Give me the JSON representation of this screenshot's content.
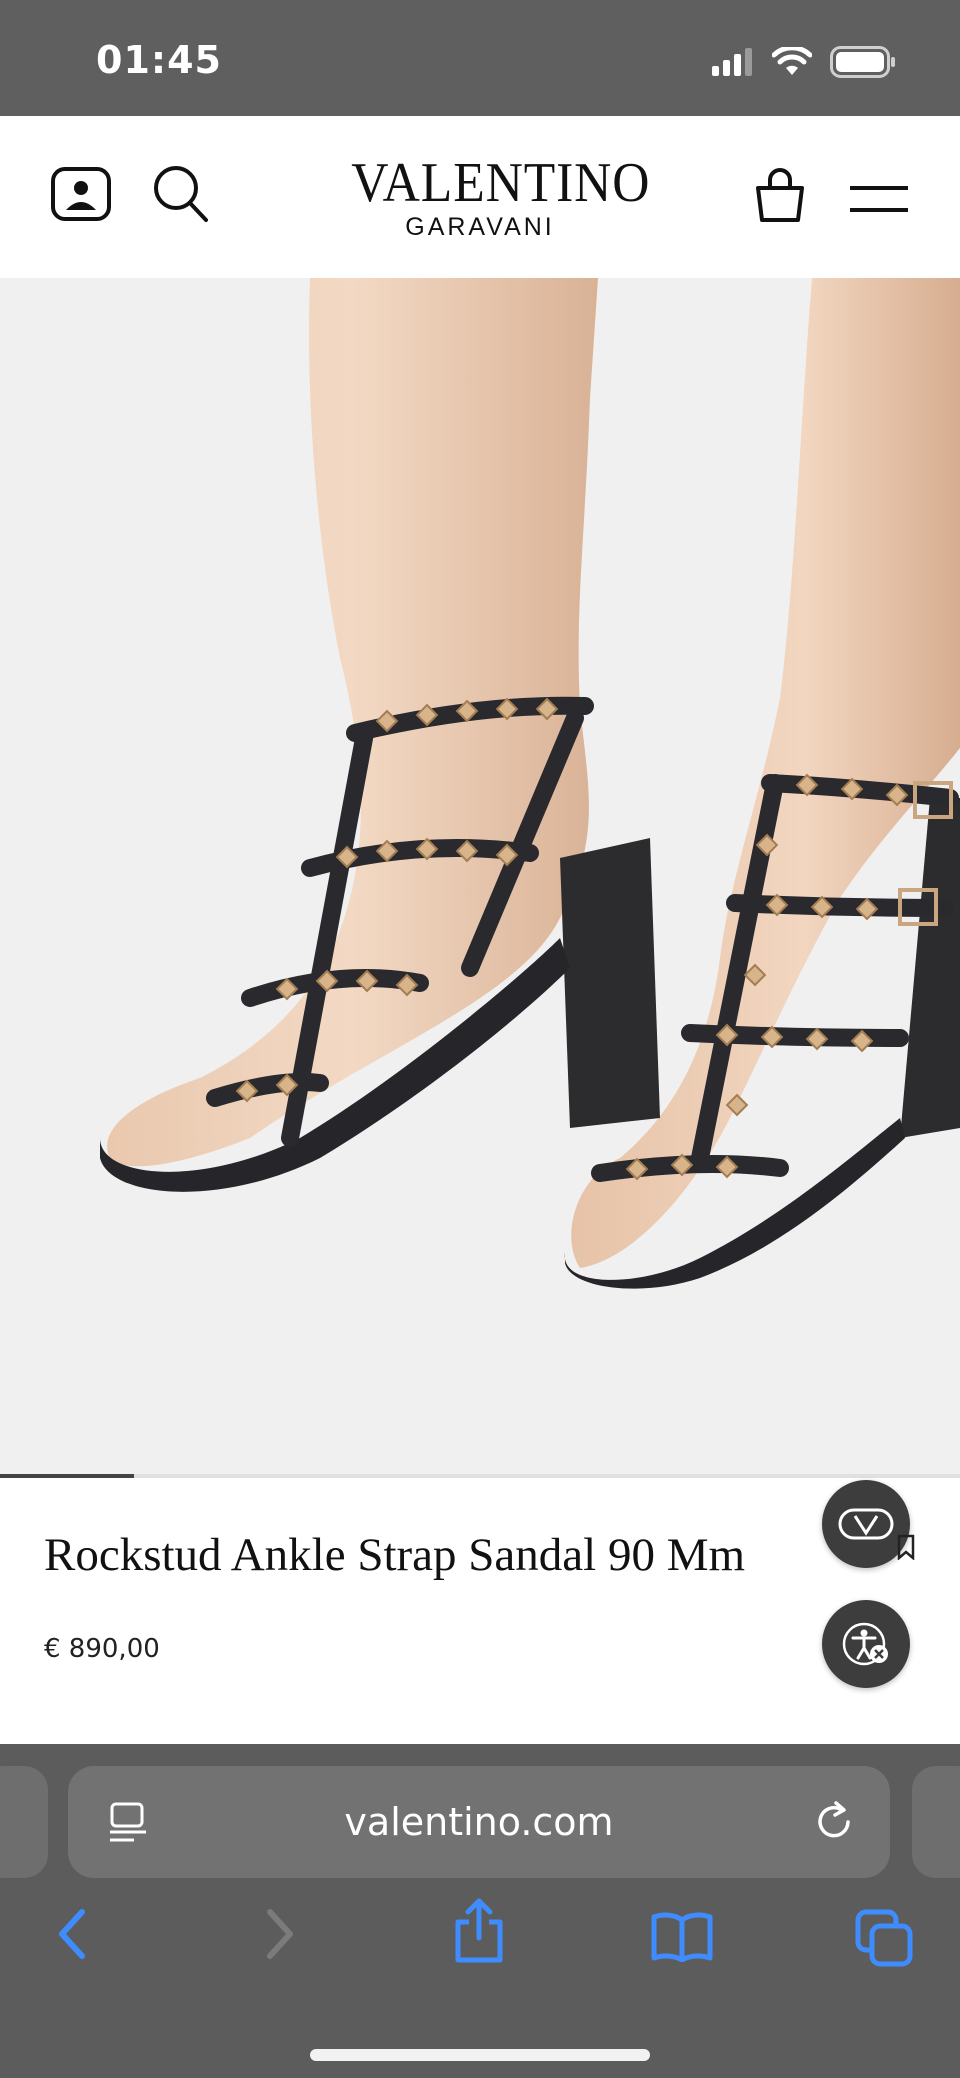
{
  "status_bar": {
    "time": "01:45"
  },
  "header": {
    "brand_name": "VALENTINO",
    "brand_sub": "GARAVANI"
  },
  "carousel": {
    "progress": 0.14
  },
  "product": {
    "title": "Rockstud Ankle Strap Sandal 90 Mm",
    "price": "€ 890,00"
  },
  "browser": {
    "url": "valentino.com"
  },
  "icons": {
    "account": "account-icon",
    "search": "search-icon",
    "bag": "shopping-bag-icon",
    "menu": "hamburger-menu-icon",
    "back": "chevron-left-icon",
    "forward": "chevron-right-icon",
    "share": "share-icon",
    "bookmarks": "book-icon",
    "tabs": "tabs-icon"
  },
  "colors": {
    "toolbar_accent": "#3f8cff",
    "status_bar": "#5f5f5f",
    "fab": "#3d3d3d"
  }
}
